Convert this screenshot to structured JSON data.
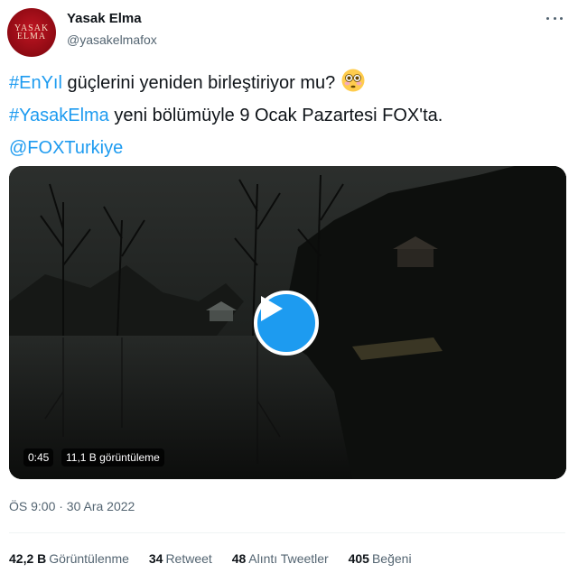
{
  "author": {
    "display_name": "Yasak Elma",
    "handle": "@yasakelmafox",
    "avatar_line1": "YASAK",
    "avatar_line2": "ELMA"
  },
  "tweet": {
    "line1": {
      "hashtag": "#EnYıl",
      "text": " güçlerini yeniden birleştiriyor mu?",
      "emoji": "flushed-face-emoji"
    },
    "line2": {
      "hashtag": "#YasakElma",
      "text": " yeni bölümüyle 9 Ocak Pazartesi FOX'ta."
    },
    "line3": {
      "mention": "@FOXTurkiye"
    }
  },
  "video": {
    "duration": "0:45",
    "views": "11,1 B görüntüleme",
    "icon": "play-icon",
    "accent": "#1d9bf0"
  },
  "timestamp": "ÖS 9:00 · 30 Ara 2022",
  "stats": [
    {
      "num": "42,2 B",
      "label": "Görüntülenme"
    },
    {
      "num": "34",
      "label": "Retweet"
    },
    {
      "num": "48",
      "label": "Alıntı Tweetler"
    },
    {
      "num": "405",
      "label": "Beğeni"
    }
  ],
  "colors": {
    "link": "#1d9bf0",
    "secondary_text": "#536471",
    "primary_text": "#0f1419",
    "brand_red": "#b0121d"
  }
}
